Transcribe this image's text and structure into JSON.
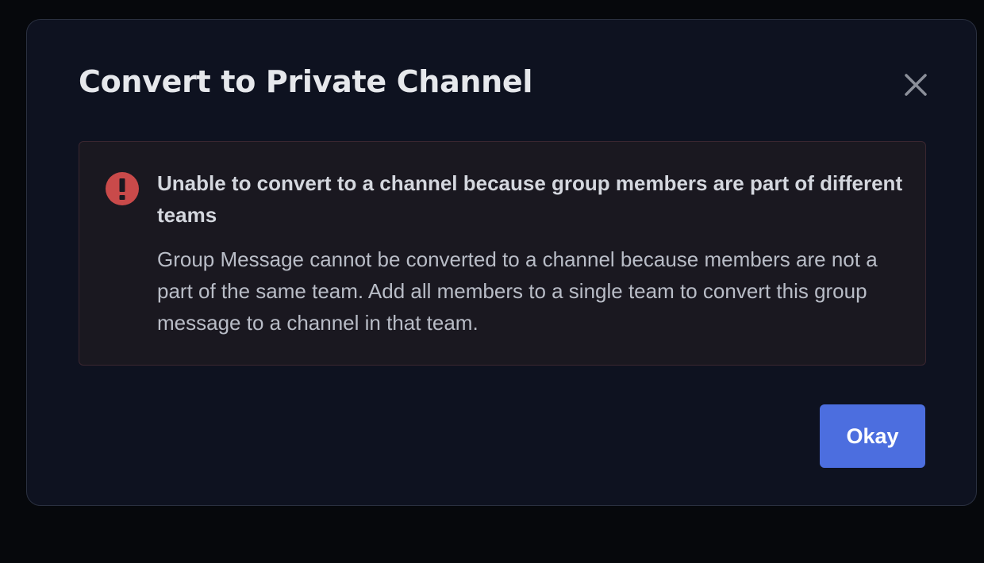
{
  "modal": {
    "title": "Convert to Private Channel",
    "close_icon": "close-icon"
  },
  "alert": {
    "icon": "error-exclamation-icon",
    "icon_color": "#c94a4a",
    "heading": "Unable to convert to a channel because group members are part of different teams",
    "body": "Group Message cannot be converted to a channel because members are not a part of the same team. Add all members to a single team to convert this group message to a channel in that team."
  },
  "footer": {
    "okay_label": "Okay",
    "okay_color": "#4c6edf"
  }
}
